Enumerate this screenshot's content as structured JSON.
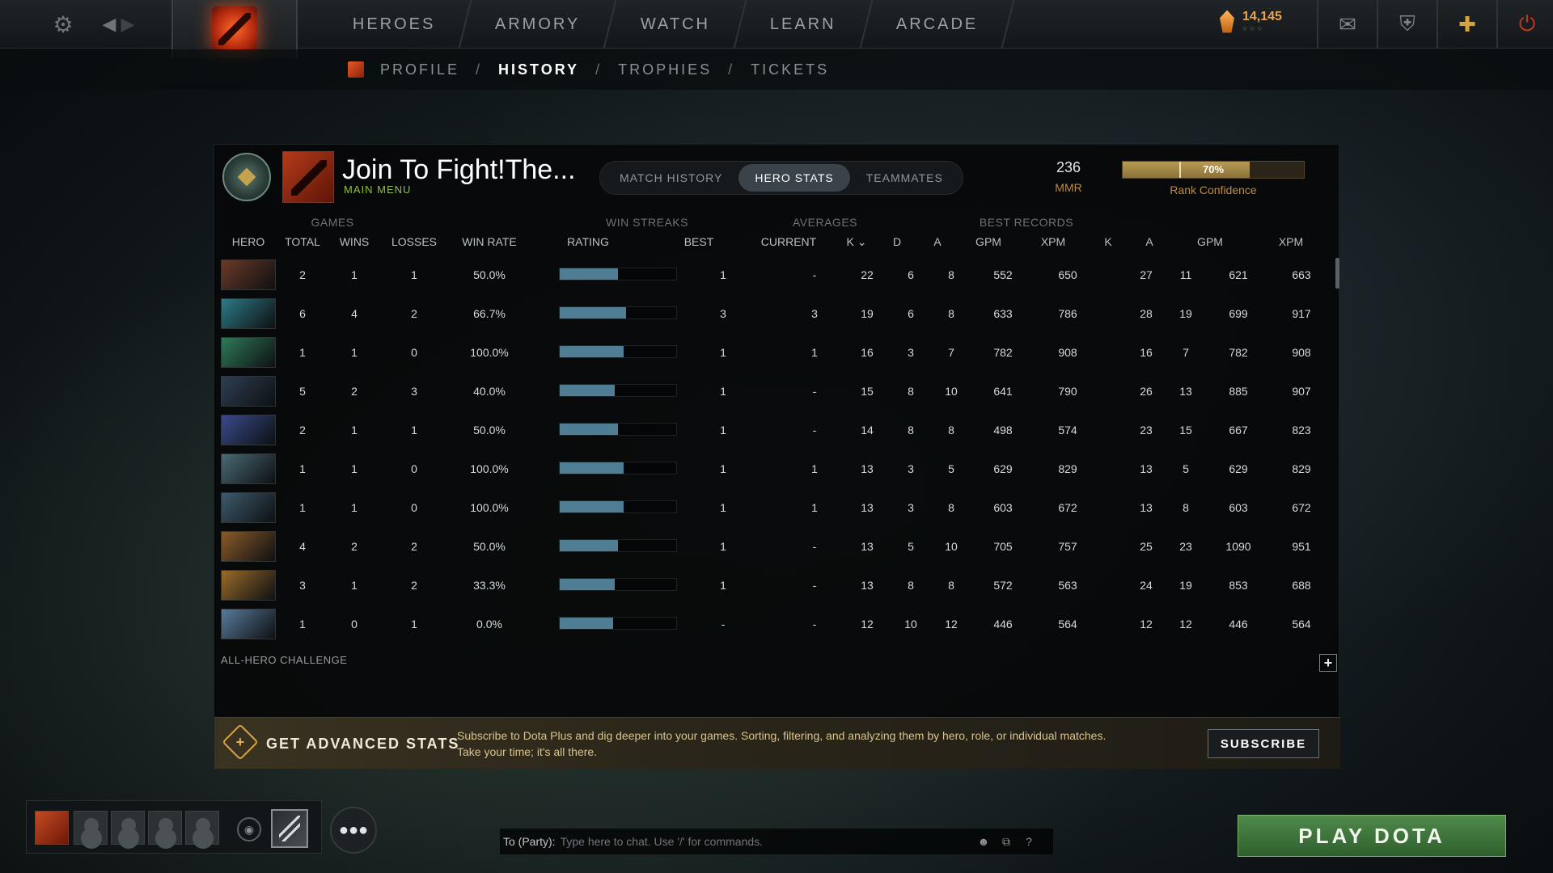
{
  "topnav": {
    "items": [
      "HEROES",
      "ARMORY",
      "WATCH",
      "LEARN",
      "ARCADE"
    ],
    "currency": "14,145",
    "currency_dots": "○○○"
  },
  "subnav": {
    "items": [
      "PROFILE",
      "HISTORY",
      "TROPHIES",
      "TICKETS"
    ],
    "separator": "/",
    "active": "HISTORY"
  },
  "profile": {
    "name": "Join To Fight!The...",
    "status": "MAIN MENU",
    "mmr_value": "236",
    "mmr_label": "MMR",
    "confidence_pct": "70%",
    "confidence_value": 0.7,
    "confidence_label": "Rank Confidence"
  },
  "tabs": [
    "MATCH HISTORY",
    "HERO STATS",
    "TEAMMATES"
  ],
  "active_tab": "HERO STATS",
  "column_groups": [
    "GAMES",
    "WIN STREAKS",
    "AVERAGES",
    "BEST RECORDS"
  ],
  "columns": [
    "HERO",
    "TOTAL",
    "WINS",
    "LOSSES",
    "WIN RATE",
    "RATING",
    "BEST",
    "CURRENT",
    "K",
    "D",
    "A",
    "GPM",
    "XPM",
    "K",
    "A",
    "GPM",
    "XPM"
  ],
  "rows": [
    {
      "total": "2",
      "wins": "1",
      "losses": "1",
      "win_rate": "50.0%",
      "rating": 0.5,
      "best": "1",
      "current": "-",
      "k": "22",
      "d": "6",
      "a": "8",
      "gpm": "552",
      "xpm": "650",
      "bk": "27",
      "ba": "11",
      "bgpm": "621",
      "bxpm": "663"
    },
    {
      "total": "6",
      "wins": "4",
      "losses": "2",
      "win_rate": "66.7%",
      "rating": 0.57,
      "best": "3",
      "current": "3",
      "k": "19",
      "d": "6",
      "a": "8",
      "gpm": "633",
      "xpm": "786",
      "bk": "28",
      "ba": "19",
      "bgpm": "699",
      "bxpm": "917"
    },
    {
      "total": "1",
      "wins": "1",
      "losses": "0",
      "win_rate": "100.0%",
      "rating": 0.55,
      "best": "1",
      "current": "1",
      "k": "16",
      "d": "3",
      "a": "7",
      "gpm": "782",
      "xpm": "908",
      "bk": "16",
      "ba": "7",
      "bgpm": "782",
      "bxpm": "908"
    },
    {
      "total": "5",
      "wins": "2",
      "losses": "3",
      "win_rate": "40.0%",
      "rating": 0.47,
      "best": "1",
      "current": "-",
      "k": "15",
      "d": "8",
      "a": "10",
      "gpm": "641",
      "xpm": "790",
      "bk": "26",
      "ba": "13",
      "bgpm": "885",
      "bxpm": "907"
    },
    {
      "total": "2",
      "wins": "1",
      "losses": "1",
      "win_rate": "50.0%",
      "rating": 0.5,
      "best": "1",
      "current": "-",
      "k": "14",
      "d": "8",
      "a": "8",
      "gpm": "498",
      "xpm": "574",
      "bk": "23",
      "ba": "15",
      "bgpm": "667",
      "bxpm": "823"
    },
    {
      "total": "1",
      "wins": "1",
      "losses": "0",
      "win_rate": "100.0%",
      "rating": 0.55,
      "best": "1",
      "current": "1",
      "k": "13",
      "d": "3",
      "a": "5",
      "gpm": "629",
      "xpm": "829",
      "bk": "13",
      "ba": "5",
      "bgpm": "629",
      "bxpm": "829"
    },
    {
      "total": "1",
      "wins": "1",
      "losses": "0",
      "win_rate": "100.0%",
      "rating": 0.55,
      "best": "1",
      "current": "1",
      "k": "13",
      "d": "3",
      "a": "8",
      "gpm": "603",
      "xpm": "672",
      "bk": "13",
      "ba": "8",
      "bgpm": "603",
      "bxpm": "672"
    },
    {
      "total": "4",
      "wins": "2",
      "losses": "2",
      "win_rate": "50.0%",
      "rating": 0.5,
      "best": "1",
      "current": "-",
      "k": "13",
      "d": "5",
      "a": "10",
      "gpm": "705",
      "xpm": "757",
      "bk": "25",
      "ba": "23",
      "bgpm": "1090",
      "bxpm": "951"
    },
    {
      "total": "3",
      "wins": "1",
      "losses": "2",
      "win_rate": "33.3%",
      "rating": 0.47,
      "best": "1",
      "current": "-",
      "k": "13",
      "d": "8",
      "a": "8",
      "gpm": "572",
      "xpm": "563",
      "bk": "24",
      "ba": "19",
      "bgpm": "853",
      "bxpm": "688"
    },
    {
      "total": "1",
      "wins": "0",
      "losses": "1",
      "win_rate": "0.0%",
      "rating": 0.46,
      "best": "-",
      "current": "-",
      "k": "12",
      "d": "10",
      "a": "12",
      "gpm": "446",
      "xpm": "564",
      "bk": "12",
      "ba": "12",
      "bgpm": "446",
      "bxpm": "564"
    }
  ],
  "hero_colors": [
    "#6b3a28",
    "#2e7a86",
    "#2f7a58",
    "#2f3e52",
    "#3a4a8a",
    "#4a6a74",
    "#3d5a6c",
    "#8a5a2a",
    "#9a6a2a",
    "#5a7a9a"
  ],
  "all_hero_challenge": "ALL-HERO CHALLENGE",
  "promo": {
    "title": "GET ADVANCED STATS",
    "text": "Subscribe to Dota Plus and dig deeper into your games. Sorting, filtering, and analyzing them by hero, role, or individual matches. Take your time; it's all there.",
    "button": "SUBSCRIBE"
  },
  "chat": {
    "label": "To (Party):",
    "placeholder": "Type here to chat. Use '/' for commands."
  },
  "play_button": "PLAY DOTA",
  "colors": {
    "accent_gold": "#c08a3e",
    "rating_bar": "#4f7d93",
    "play_green": "#3f7a3b",
    "status_green": "#8fbf3a"
  }
}
